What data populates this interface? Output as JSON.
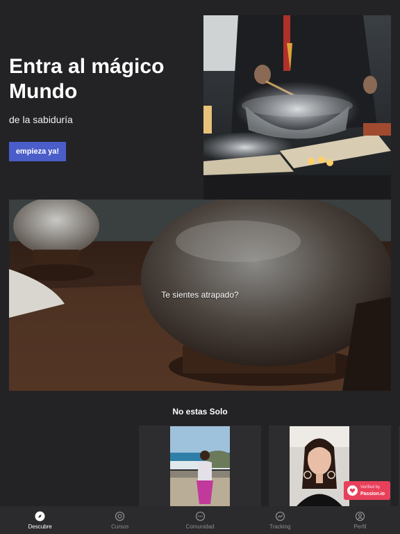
{
  "hero": {
    "title": "Entra al mágico Mundo",
    "subtitle": "de la sabiduría",
    "cta_label": "empieza ya!"
  },
  "banner": {
    "text": "Te sientes atrapado?"
  },
  "community": {
    "title": "No estas Solo"
  },
  "badge": {
    "line1": "Verified by",
    "line2": "Passion.io"
  },
  "nav": {
    "items": [
      {
        "label": "Descubre",
        "icon": "compass-icon",
        "active": true
      },
      {
        "label": "Cursos",
        "icon": "courses-icon",
        "active": false
      },
      {
        "label": "Comunidad",
        "icon": "chat-icon",
        "active": false
      },
      {
        "label": "Tracking",
        "icon": "trending-icon",
        "active": false
      },
      {
        "label": "Perfil",
        "icon": "profile-icon",
        "active": false
      }
    ]
  },
  "colors": {
    "background": "#232325",
    "accent": "#4a5dc9",
    "badge": "#e8405a",
    "nav_bg": "#2b2b2d"
  }
}
